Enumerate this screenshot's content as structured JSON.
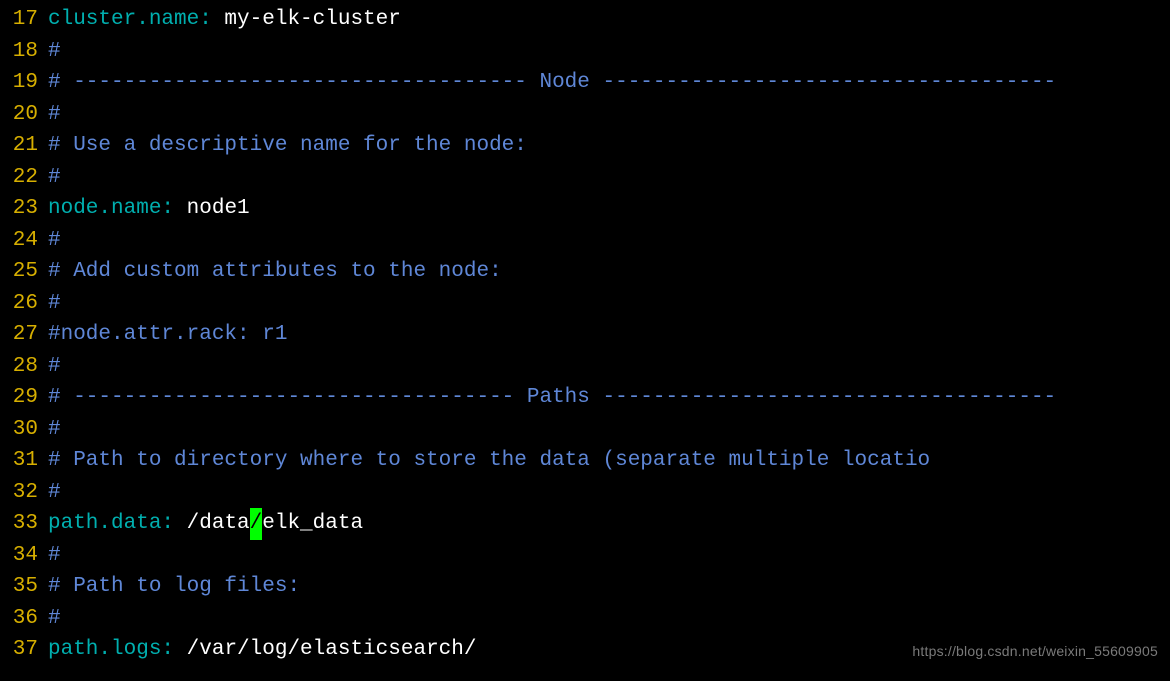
{
  "watermark": "https://blog.csdn.net/weixin_55609905",
  "lines": [
    {
      "number": "17",
      "segments": [
        {
          "class": "keyword",
          "text": "cluster.name:"
        },
        {
          "class": "value",
          "text": " my-elk-cluster"
        }
      ]
    },
    {
      "number": "18",
      "segments": [
        {
          "class": "comment",
          "text": "#"
        }
      ]
    },
    {
      "number": "19",
      "segments": [
        {
          "class": "comment",
          "text": "# ------------------------------------ Node ------------------------------------"
        }
      ]
    },
    {
      "number": "20",
      "segments": [
        {
          "class": "comment",
          "text": "#"
        }
      ]
    },
    {
      "number": "21",
      "segments": [
        {
          "class": "comment",
          "text": "# Use a descriptive name for the node:"
        }
      ]
    },
    {
      "number": "22",
      "segments": [
        {
          "class": "comment",
          "text": "#"
        }
      ]
    },
    {
      "number": "23",
      "segments": [
        {
          "class": "keyword",
          "text": "node.name:"
        },
        {
          "class": "value",
          "text": " node1"
        }
      ]
    },
    {
      "number": "24",
      "segments": [
        {
          "class": "comment",
          "text": "#"
        }
      ]
    },
    {
      "number": "25",
      "segments": [
        {
          "class": "comment",
          "text": "# Add custom attributes to the node:"
        }
      ]
    },
    {
      "number": "26",
      "segments": [
        {
          "class": "comment",
          "text": "#"
        }
      ]
    },
    {
      "number": "27",
      "segments": [
        {
          "class": "comment",
          "text": "#node.attr.rack: r1"
        }
      ]
    },
    {
      "number": "28",
      "segments": [
        {
          "class": "comment",
          "text": "#"
        }
      ]
    },
    {
      "number": "29",
      "segments": [
        {
          "class": "comment",
          "text": "# ----------------------------------- Paths ------------------------------------"
        }
      ]
    },
    {
      "number": "30",
      "segments": [
        {
          "class": "comment",
          "text": "#"
        }
      ]
    },
    {
      "number": "31",
      "segments": [
        {
          "class": "comment",
          "text": "# Path to directory where to store the data (separate multiple locatio"
        }
      ]
    },
    {
      "number": "32",
      "segments": [
        {
          "class": "comment",
          "text": "#"
        }
      ]
    },
    {
      "number": "33",
      "segments": [
        {
          "class": "keyword",
          "text": "path.data:"
        },
        {
          "class": "value",
          "text": " /data"
        },
        {
          "class": "cursor",
          "text": "/"
        },
        {
          "class": "value",
          "text": "elk_data"
        }
      ]
    },
    {
      "number": "34",
      "segments": [
        {
          "class": "comment",
          "text": "#"
        }
      ]
    },
    {
      "number": "35",
      "segments": [
        {
          "class": "comment",
          "text": "# Path to log files:"
        }
      ]
    },
    {
      "number": "36",
      "segments": [
        {
          "class": "comment",
          "text": "#"
        }
      ]
    },
    {
      "number": "37",
      "segments": [
        {
          "class": "keyword",
          "text": "path.logs:"
        },
        {
          "class": "value",
          "text": " /var/log/elasticsearch/"
        }
      ]
    }
  ]
}
